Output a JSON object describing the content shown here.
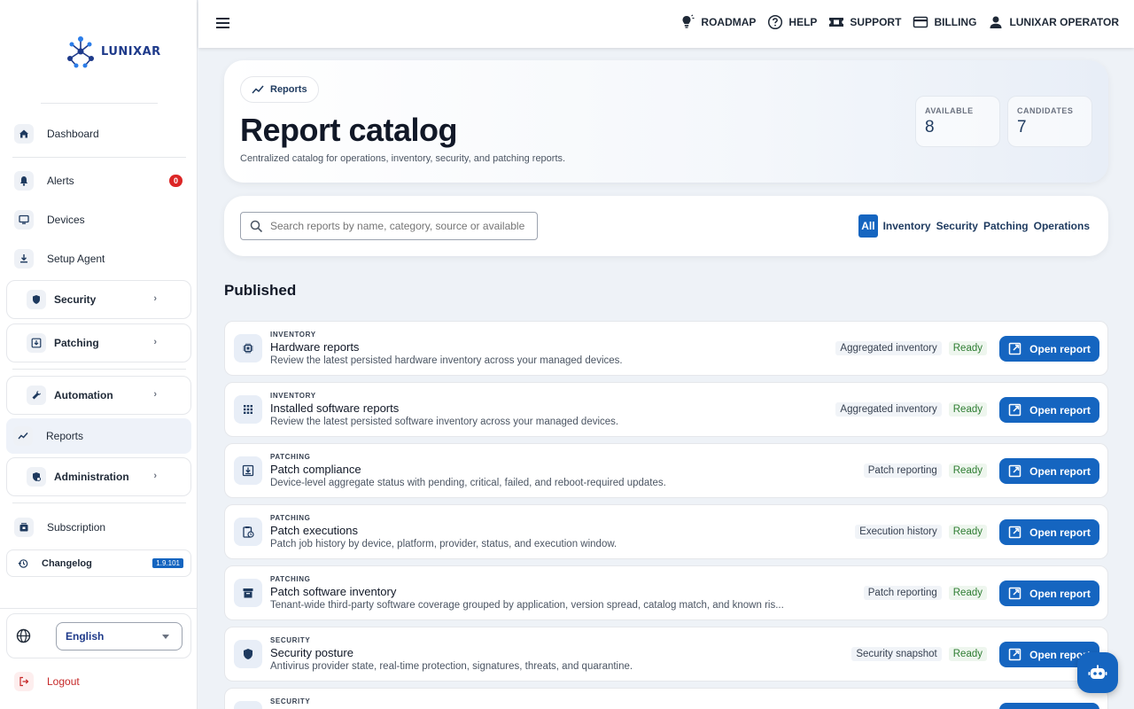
{
  "brand": {
    "name": "LUNIXAR"
  },
  "sidebar": {
    "dashboard": "Dashboard",
    "alerts": "Alerts",
    "alerts_count": "0",
    "devices": "Devices",
    "setup_agent": "Setup Agent",
    "security": "Security",
    "patching": "Patching",
    "automation": "Automation",
    "reports": "Reports",
    "administration": "Administration",
    "subscription": "Subscription",
    "changelog": "Changelog",
    "version": "1.9.101",
    "language": "English",
    "logout": "Logout"
  },
  "topbar": {
    "roadmap": "ROADMAP",
    "help": "HELP",
    "support": "SUPPORT",
    "billing": "BILLING",
    "user": "LUNIXAR OPERATOR"
  },
  "hero": {
    "crumb": "Reports",
    "title": "Report catalog",
    "subtitle": "Centralized catalog for operations, inventory, security, and patching reports.",
    "available_label": "AVAILABLE",
    "available_value": "8",
    "candidates_label": "CANDIDATES",
    "candidates_value": "7"
  },
  "search": {
    "placeholder": "Search reports by name, category, source or available"
  },
  "filters": [
    "All",
    "Inventory",
    "Security",
    "Patching",
    "Operations"
  ],
  "section_title": "Published",
  "open_label": "Open report",
  "reports": [
    {
      "category": "INVENTORY",
      "name": "Hardware reports",
      "description": "Review the latest persisted hardware inventory across your managed devices.",
      "source": "Aggregated inventory",
      "status": "Ready",
      "icon": "chip-icon"
    },
    {
      "category": "INVENTORY",
      "name": "Installed software reports",
      "description": "Review the latest persisted software inventory across your managed devices.",
      "source": "Aggregated inventory",
      "status": "Ready",
      "icon": "apps-grid-icon"
    },
    {
      "category": "PATCHING",
      "name": "Patch compliance",
      "description": "Device-level aggregate status with pending, critical, failed, and reboot-required updates.",
      "source": "Patch reporting",
      "status": "Ready",
      "icon": "download-box-icon"
    },
    {
      "category": "PATCHING",
      "name": "Patch executions",
      "description": "Patch job history by device, platform, provider, status, and execution window.",
      "source": "Execution history",
      "status": "Ready",
      "icon": "clipboard-clock-icon"
    },
    {
      "category": "PATCHING",
      "name": "Patch software inventory",
      "description": "Tenant-wide third-party software coverage grouped by application, version spread, catalog match, and known ris...",
      "source": "Patch reporting",
      "status": "Ready",
      "icon": "archive-icon"
    },
    {
      "category": "SECURITY",
      "name": "Security posture",
      "description": "Antivirus provider state, real-time protection, signatures, threats, and quarantine.",
      "source": "Security snapshot",
      "status": "Ready",
      "icon": "shield-icon"
    },
    {
      "category": "SECURITY",
      "name": "",
      "description": "",
      "source": "",
      "status": "",
      "icon": "shield-icon"
    }
  ],
  "colors": {
    "primary": "#1565c0",
    "ready": "#2e7d32",
    "alert": "#dc2626",
    "logout": "#c62828"
  }
}
